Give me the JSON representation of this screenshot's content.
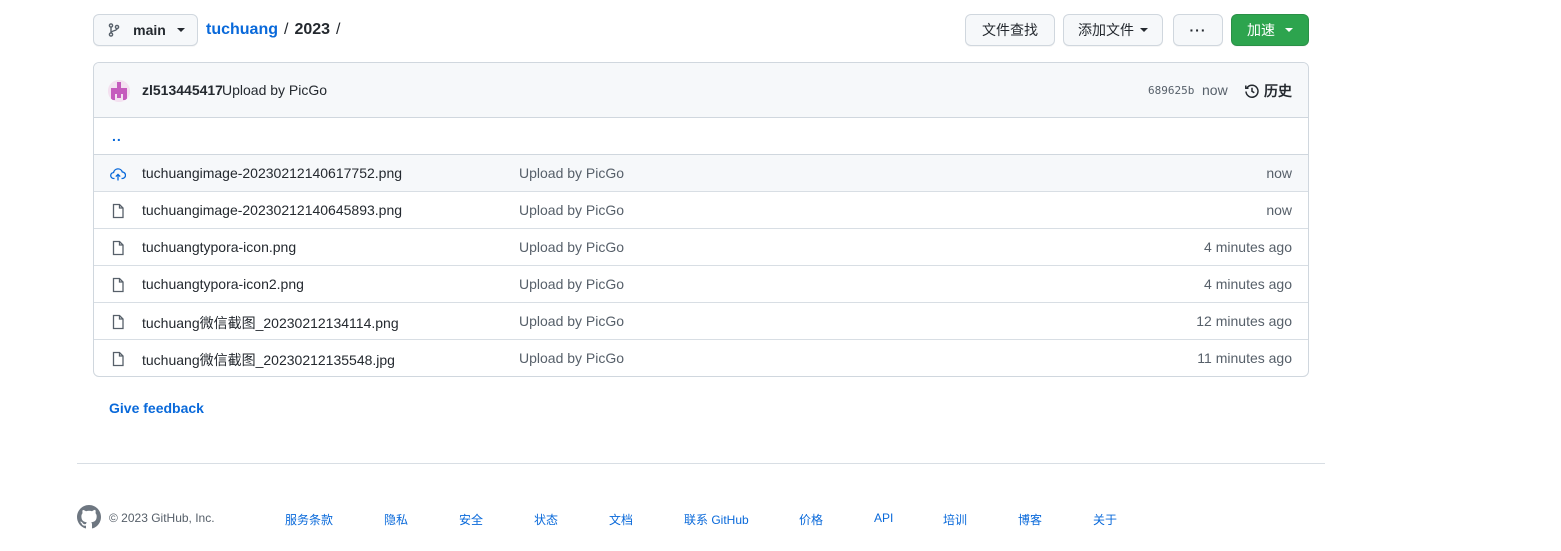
{
  "toolbar": {
    "branch": "main",
    "repo": "tuchuang",
    "sep1": "/",
    "dir": "2023",
    "sep2": "/",
    "find_file": "文件查找",
    "add_file": "添加文件",
    "more": "···",
    "code": "加速"
  },
  "commit": {
    "author": "zl513445417",
    "message": "Upload by PicGo",
    "sha": "689625b",
    "time": "now",
    "history": "历史"
  },
  "up_link": "..",
  "files": [
    {
      "name": "tuchuangimage-20230212140617752.png",
      "message": "Upload by PicGo",
      "time": "now",
      "icon": "cloud-upload-icon"
    },
    {
      "name": "tuchuangimage-20230212140645893.png",
      "message": "Upload by PicGo",
      "time": "now",
      "icon": "file-icon"
    },
    {
      "name": "tuchuangtypora-icon.png",
      "message": "Upload by PicGo",
      "time": "4 minutes ago",
      "icon": "file-icon"
    },
    {
      "name": "tuchuangtypora-icon2.png",
      "message": "Upload by PicGo",
      "time": "4 minutes ago",
      "icon": "file-icon"
    },
    {
      "name": "tuchuang微信截图_20230212134114.png",
      "message": "Upload by PicGo",
      "time": "12 minutes ago",
      "icon": "file-icon"
    },
    {
      "name": "tuchuang微信截图_20230212135548.jpg",
      "message": "Upload by PicGo",
      "time": "11 minutes ago",
      "icon": "file-icon"
    }
  ],
  "feedback": "Give feedback",
  "footer": {
    "copyright": "© 2023 GitHub, Inc.",
    "links": [
      "服务条款",
      "隐私",
      "安全",
      "状态",
      "文档",
      "联系 GitHub",
      "价格",
      "API",
      "培训",
      "博客",
      "关于"
    ]
  },
  "colors": {
    "accent_blue": "#0969da",
    "code_button_green": "#2da44e",
    "muted_text": "#57606a",
    "border": "#d0d7de"
  }
}
